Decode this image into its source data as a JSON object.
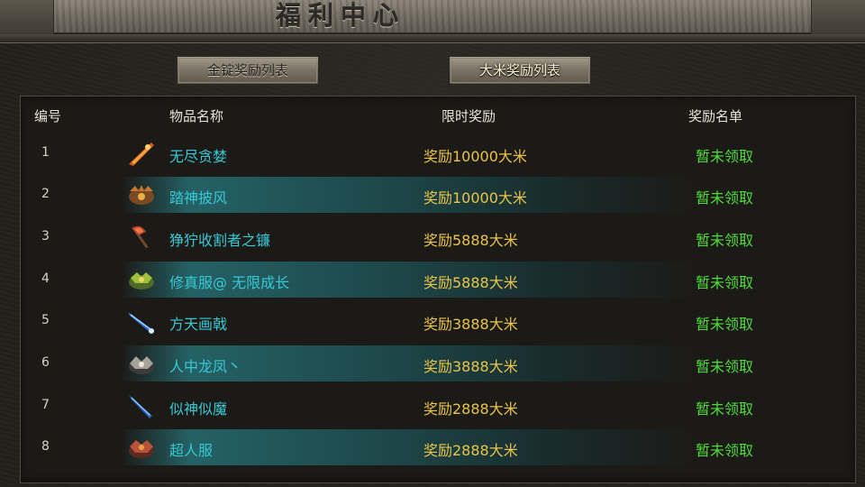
{
  "header": {
    "title": "福利中心"
  },
  "tabs": [
    {
      "label": "金锭奖励列表",
      "active": false
    },
    {
      "label": "大米奖励列表",
      "active": true
    }
  ],
  "columns": {
    "num": "编号",
    "item": "物品名称",
    "reward": "限时奖励",
    "list": "奖励名单"
  },
  "rows": [
    {
      "num": "1",
      "icon": "flame-blade-icon",
      "name": "无尽贪婪",
      "reward": "奖励10000大米",
      "status": "暂未领取",
      "highlight": false
    },
    {
      "num": "2",
      "icon": "beast-armor-icon",
      "name": "踏神披风",
      "reward": "奖励10000大米",
      "status": "暂未领取",
      "highlight": true
    },
    {
      "num": "3",
      "icon": "axe-icon",
      "name": "狰狞收割者之镰",
      "reward": "奖励5888大米",
      "status": "暂未领取",
      "highlight": false
    },
    {
      "num": "4",
      "icon": "green-armor-icon",
      "name": "修真服@ 无限成长",
      "reward": "奖励5888大米",
      "status": "暂未领取",
      "highlight": true
    },
    {
      "num": "5",
      "icon": "blue-halberd-icon",
      "name": "方天画戟",
      "reward": "奖励3888大米",
      "status": "暂未领取",
      "highlight": false
    },
    {
      "num": "6",
      "icon": "dragon-armor-icon",
      "name": "人中龙凤丶",
      "reward": "奖励3888大米",
      "status": "暂未领取",
      "highlight": true
    },
    {
      "num": "7",
      "icon": "blue-sword-icon",
      "name": "似神似魔",
      "reward": "奖励2888大米",
      "status": "暂未领取",
      "highlight": false
    },
    {
      "num": "8",
      "icon": "red-armor-icon",
      "name": "超人服",
      "reward": "奖励2888大米",
      "status": "暂未领取",
      "highlight": true
    }
  ]
}
